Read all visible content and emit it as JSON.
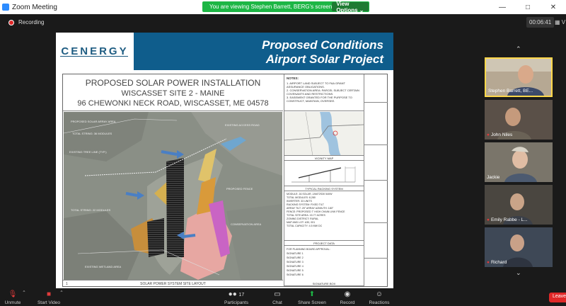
{
  "window": {
    "title": "Zoom Meeting"
  },
  "share_banner": {
    "text": "You are viewing Stephen Barrett, BERG's screen",
    "view_options": "View Options ⌄"
  },
  "topbar": {
    "recording": "Recording",
    "timer": "00:06:41",
    "view": "V"
  },
  "slide": {
    "logo": "CENERGY",
    "title1": "Proposed Conditions",
    "title2": "Airport Solar Project"
  },
  "sheet": {
    "title1": "PROPOSED SOLAR POWER INSTALLATION",
    "title2": "WISCASSET SITE 2 - MAINE",
    "title3": "96 CHEWONKI NECK ROAD, WISCASSET, ME 04578",
    "map_caption": "SOLAR POWER SYSTEM SITE LAYOUT",
    "map_caption_num": "1",
    "notes_title": "NOTES:",
    "notes": [
      "1. AIRPORT LAND SUBJECT TO FAA GRANT ASSURANCE OBLIGATIONS.",
      "2. CONSERVATION AREA: PARCEL SUBJECT CERTAIN COVENANTS AND RESTRICTIONS.",
      "3. EASEMENT GRANTED FOR THE PURPOSE TO CONSTRUCT, MAINTAIN, OVERSEE."
    ],
    "vicinity_caption": "VICINITY MAP",
    "racking_caption": "TYPICAL RACKING SYSTEM",
    "project_caption": "PROJECT DATA",
    "project_lines": [
      "MODULE: JA SOLAR, JAM72S30 540W",
      "TOTAL MODULES: 8,280",
      "INVERTER: 33 UNITS",
      "RACKING SYSTEM: FIXED TILT",
      "ARRAY TILT: 25°   ARRAY AZIMUTH: 180°",
      "FENCE: PROPOSED 7' HIGH CHAIN LINK FENCE",
      "TOTAL SITE AREA: 15.77 ACRES",
      "ZONING DISTRICT: RURAL",
      "MAP AND LOT: U30, 001",
      "TOTAL CAPACITY: 4.5 MW DC"
    ],
    "signature_title": "FOR PLANNING BOARD APPROVAL:",
    "signatures": [
      "SIGNATURE 1",
      "SIGNATURE 2",
      "SIGNATURE 3",
      "SIGNATURE 4",
      "SIGNATURE 5",
      "SIGNATURE 6"
    ],
    "signature_caption": "SIGNATURE BOX"
  },
  "gallery": {
    "participants": [
      {
        "name": "Stephen Barrett, BE...",
        "active": true
      },
      {
        "name": "John Niles",
        "active": false
      },
      {
        "name": "Jackie",
        "active": false
      },
      {
        "name": "Emily Rabbe - L...",
        "active": false
      },
      {
        "name": "Richard",
        "active": false
      }
    ]
  },
  "toolbar": {
    "unmute": "Unmute",
    "start_video": "Start Video",
    "participants": "Participants",
    "participants_count": "17",
    "chat": "Chat",
    "share_screen": "Share Screen",
    "record": "Record",
    "reactions": "Reactions",
    "leave": "Leave"
  },
  "colors": {
    "share_banner": "#1db645",
    "slide_header": "#0f5d8c",
    "active_tile": "#ffd84a",
    "leave": "#e02828",
    "share_screen_icon": "#1db645"
  }
}
